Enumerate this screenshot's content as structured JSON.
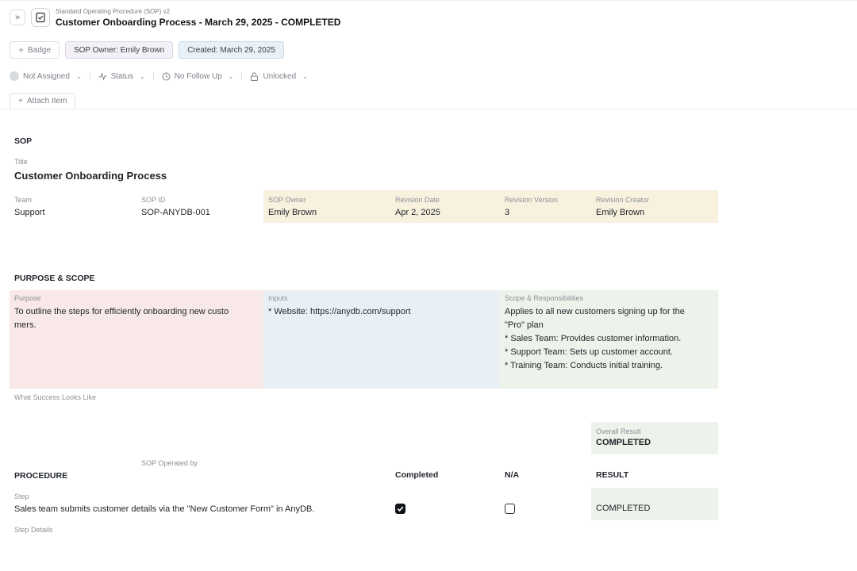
{
  "header": {
    "breadcrumb": "Standard Operating Procedure (SOP) v2",
    "title": "Customer Onboarding Process - March 29, 2025 - COMPLETED",
    "expand_glyph": "»"
  },
  "badges": {
    "add_label": "Badge",
    "owner": "SOP Owner: Emily Brown",
    "created": "Created: March 29, 2025"
  },
  "meta": {
    "assignee": "Not Assigned",
    "status": "Status",
    "follow_up": "No Follow Up",
    "lock": "Unlocked"
  },
  "attach_label": "Attach Item",
  "sop": {
    "heading": "SOP",
    "title_label": "Title",
    "title_value": "Customer Onboarding Process",
    "team_label": "Team",
    "team_value": "Support",
    "id_label": "SOP ID",
    "id_value": "SOP-ANYDB-001",
    "owner_label": "SOP Owner",
    "owner_value": "Emily Brown",
    "rev_date_label": "Revision Date",
    "rev_date_value": "Apr 2, 2025",
    "rev_version_label": "Revision Version",
    "rev_version_value": "3",
    "rev_creator_label": "Revision Creator",
    "rev_creator_value": "Emily Brown"
  },
  "purpose_scope": {
    "heading": "PURPOSE & SCOPE",
    "purpose_label": "Purpose",
    "purpose_line1": "To outline the steps for efficiently onboarding new custo",
    "purpose_line2": "mers.",
    "inputs_label": "Inputs",
    "inputs_value": "* Website: https://anydb.com/support",
    "scope_label": "Scope & Responsibilities",
    "scope_line1": "Applies to all new customers signing up for the",
    "scope_line2": "\"Pro\" plan",
    "scope_line3": "* Sales Team: Provides customer information.",
    "scope_line4": "* Support Team: Sets up customer account.",
    "scope_line5": "* Training Team: Conducts initial training.",
    "success_label": "What Success Looks Like"
  },
  "overall": {
    "label": "Overall Result",
    "value": "COMPLETED"
  },
  "procedure": {
    "operated_by_label": "SOP Operated by",
    "heading": "PROCEDURE",
    "col_completed": "Completed",
    "col_na": "N/A",
    "col_result": "RESULT",
    "step_label": "Step",
    "step_text": "Sales team submits customer details via the \"New Customer Form\" in AnyDB.",
    "step_completed": true,
    "step_na": false,
    "step_result": "COMPLETED",
    "step_details_label": "Step Details"
  },
  "icons": {
    "expand": "chevrons-right-icon",
    "doc": "checklist-icon",
    "add": "plus-icon",
    "user": "user-avatar-icon",
    "status": "activity-icon",
    "clock": "clock-icon",
    "lock": "unlock-icon",
    "chevron": "chevron-down-icon"
  }
}
